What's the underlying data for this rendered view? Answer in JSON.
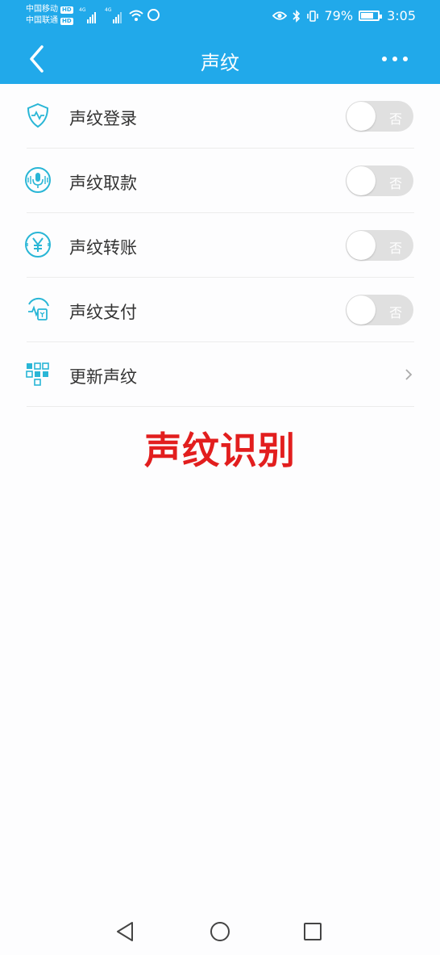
{
  "status_bar": {
    "carrier_1": "中国移动",
    "carrier_2": "中国联通",
    "hd_badge": "HD",
    "net_1": "4G",
    "net_2": "4G",
    "battery_percent": "79%",
    "battery_level": 0.79,
    "time": "3:05",
    "icons": [
      "eye-icon",
      "bluetooth-icon",
      "vibrate-icon"
    ]
  },
  "header": {
    "title": "声纹",
    "back_icon": "chevron-left-icon",
    "more_icon": "more-dots-icon"
  },
  "settings": [
    {
      "label": "声纹登录",
      "icon": "shield-icon",
      "toggle_label": "否",
      "on": false
    },
    {
      "label": "声纹取款",
      "icon": "microphone-icon",
      "toggle_label": "否",
      "on": false
    },
    {
      "label": "声纹转账",
      "icon": "yuan-icon",
      "toggle_label": "否",
      "on": false
    },
    {
      "label": "声纹支付",
      "icon": "payment-icon",
      "toggle_label": "否",
      "on": false
    },
    {
      "label": "更新声纹",
      "icon": "grid-icon"
    }
  ],
  "overlay_text": "声纹识别",
  "colors": {
    "accent": "#21a9ea",
    "icon": "#29b6d6",
    "overlay_red": "#e21e1e",
    "toggle_off": "#e0e0e0"
  }
}
